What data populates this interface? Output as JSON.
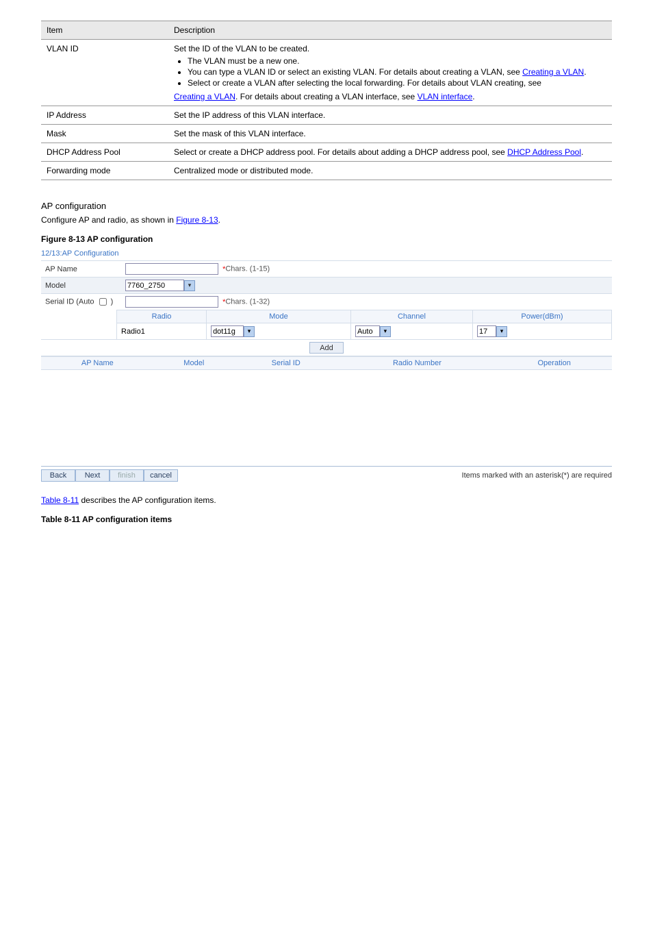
{
  "doc_table": {
    "headers": [
      "Item",
      "Description"
    ],
    "rows": [
      {
        "item": "VLAN ID",
        "desc_intro": "Set the ID of the VLAN to be created.",
        "bullets": [
          {
            "text": "The VLAN must be a new one.",
            "link": null,
            "post": null
          },
          {
            "text": "You can type a VLAN ID or select an existing VLAN. For details about creating a VLAN, see ",
            "link": "Creating a VLAN",
            "post": "."
          },
          {
            "text": "Select or create a VLAN after selecting the local forwarding. For details about VLAN creating, see ",
            "link": null,
            "post": null
          }
        ],
        "final_links": [
          "Creating a VLAN",
          ".",
          "VLAN interface"
        ],
        "vlan_intf_post": "For details about creating a VLAN interface, see"
      },
      {
        "item": "IP Address",
        "desc": "Set the IP address of this VLAN interface."
      },
      {
        "item": "Mask",
        "desc": "Set the mask of this VLAN interface."
      },
      {
        "item": "DHCP Address Pool",
        "desc": "Select or create a DHCP address pool. For details about adding a DHCP address pool, see ",
        "link": "DHCP Address Pool",
        "post": "."
      },
      {
        "item": "Forwarding mode",
        "desc": "Centralized mode or distributed mode."
      }
    ]
  },
  "step12": {
    "heading": "AP configuration",
    "text1": "Configure AP and radio, as shown in ",
    "figlink": "Figure 8-13",
    "text2": ".",
    "caption": "Figure 8-13 AP configuration"
  },
  "cfg": {
    "title": "12/13:AP Configuration",
    "ap_name_lbl": "AP Name",
    "ap_name_hint": "Chars. (1-15)",
    "model_lbl": "Model",
    "model_val": "7760_2750",
    "serial_lbl": "Serial ID (Auto",
    "serial_lbl_close": ")",
    "serial_hint": "Chars. (1-32)",
    "radio_headers": [
      "Radio",
      "Mode",
      "Channel",
      "Power(dBm)"
    ],
    "radio_row": {
      "radio": "Radio1",
      "mode": "dot11g",
      "channel": "Auto",
      "power": "17"
    },
    "add_btn": "Add",
    "list_headers": [
      "AP Name",
      "Model",
      "Serial ID",
      "Radio Number",
      "Operation"
    ]
  },
  "nav": {
    "back": "Back",
    "next": "Next",
    "finish": "finish",
    "cancel": "cancel",
    "req": "Items marked with an asterisk(*) are required"
  },
  "tbl_link": {
    "text": "Table 8-11",
    "post": " describes the AP configuration items."
  },
  "tbl_caption": "Table 8-11 AP configuration items"
}
